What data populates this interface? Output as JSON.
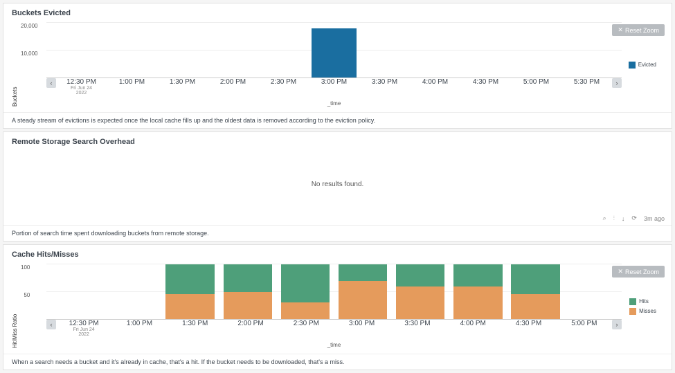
{
  "panel1": {
    "title": "Buckets Evicted",
    "caption": "A steady stream of evictions is expected once the local cache fills up and the oldest data is removed according to the eviction policy.",
    "reset": "Reset Zoom",
    "ylabel": "Buckets",
    "xlabel": "_time",
    "legend": [
      {
        "label": "Evicted",
        "color": "#1a6ea0"
      }
    ]
  },
  "panel2": {
    "title": "Remote Storage Search Overhead",
    "empty": "No results found.",
    "caption": "Portion of search time spent downloading buckets from remote storage.",
    "refresh": "3m ago"
  },
  "panel3": {
    "title": "Cache Hits/Misses",
    "caption": "When a search needs a bucket and it's already in cache, that's a hit. If the bucket needs to be downloaded, that's a miss.",
    "reset": "Reset Zoom",
    "ylabel": "Hit/Miss Ratio",
    "xlabel": "_time",
    "legend": [
      {
        "label": "Hits",
        "color": "#4e9f7a"
      },
      {
        "label": "Misses",
        "color": "#e59b5c"
      }
    ]
  },
  "chart_data": [
    {
      "type": "bar",
      "title": "Buckets Evicted",
      "ylabel": "Buckets",
      "xlabel": "_time",
      "ylim": [
        0,
        20000
      ],
      "yticks": [
        10000,
        20000
      ],
      "ytick_labels": [
        "10,000",
        "20,000"
      ],
      "xticks": [
        "12:30 PM",
        "1:00 PM",
        "1:30 PM",
        "2:00 PM",
        "2:30 PM",
        "3:00 PM",
        "3:30 PM",
        "4:00 PM",
        "4:30 PM",
        "5:00 PM",
        "5:30 PM"
      ],
      "xtick_first_sub": [
        "Fri Jun 24",
        "2022"
      ],
      "series": [
        {
          "name": "Evicted",
          "color": "#1a6ea0",
          "values": [
            0,
            0,
            0,
            0,
            0,
            18000,
            0,
            0,
            0,
            0,
            0
          ]
        }
      ]
    },
    {
      "type": "bar",
      "stacked": true,
      "title": "Cache Hits/Misses",
      "ylabel": "Hit/Miss Ratio",
      "xlabel": "_time",
      "ylim": [
        0,
        100
      ],
      "yticks": [
        50,
        100
      ],
      "ytick_labels": [
        "50",
        "100"
      ],
      "xticks": [
        "12:30 PM",
        "1:00 PM",
        "1:30 PM",
        "2:00 PM",
        "2:30 PM",
        "3:00 PM",
        "3:30 PM",
        "4:00 PM",
        "4:30 PM",
        "5:00 PM"
      ],
      "xtick_first_sub": [
        "Fri Jun 24",
        "2022"
      ],
      "series": [
        {
          "name": "Hits",
          "color": "#4e9f7a",
          "values": [
            null,
            null,
            55,
            50,
            70,
            30,
            40,
            40,
            55,
            null
          ]
        },
        {
          "name": "Misses",
          "color": "#e59b5c",
          "values": [
            null,
            null,
            45,
            50,
            30,
            70,
            60,
            60,
            45,
            null
          ]
        }
      ]
    }
  ]
}
